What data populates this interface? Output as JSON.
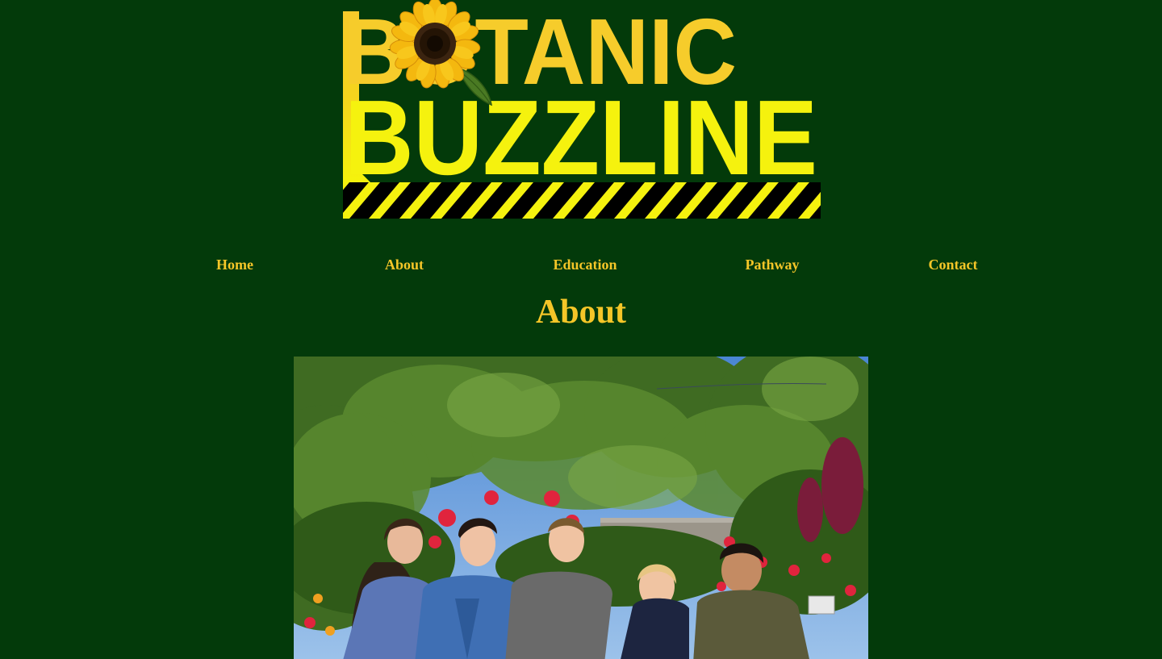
{
  "logo": {
    "line1": "BOTANIC",
    "line2": "BUZZLINE",
    "colors": {
      "yellow_top": "#f6cf2a",
      "yellow_bottom": "#f5f20e",
      "stripe_dark": "#000000"
    },
    "icon": "sunflower-icon"
  },
  "nav": {
    "items": [
      {
        "label": "Home"
      },
      {
        "label": "About"
      },
      {
        "label": "Education"
      },
      {
        "label": "Pathway"
      },
      {
        "label": "Contact"
      }
    ]
  },
  "page": {
    "title": "About"
  },
  "photo": {
    "icon": "group-photo"
  },
  "colors": {
    "background": "#033a0a",
    "accent": "#f5c628"
  }
}
